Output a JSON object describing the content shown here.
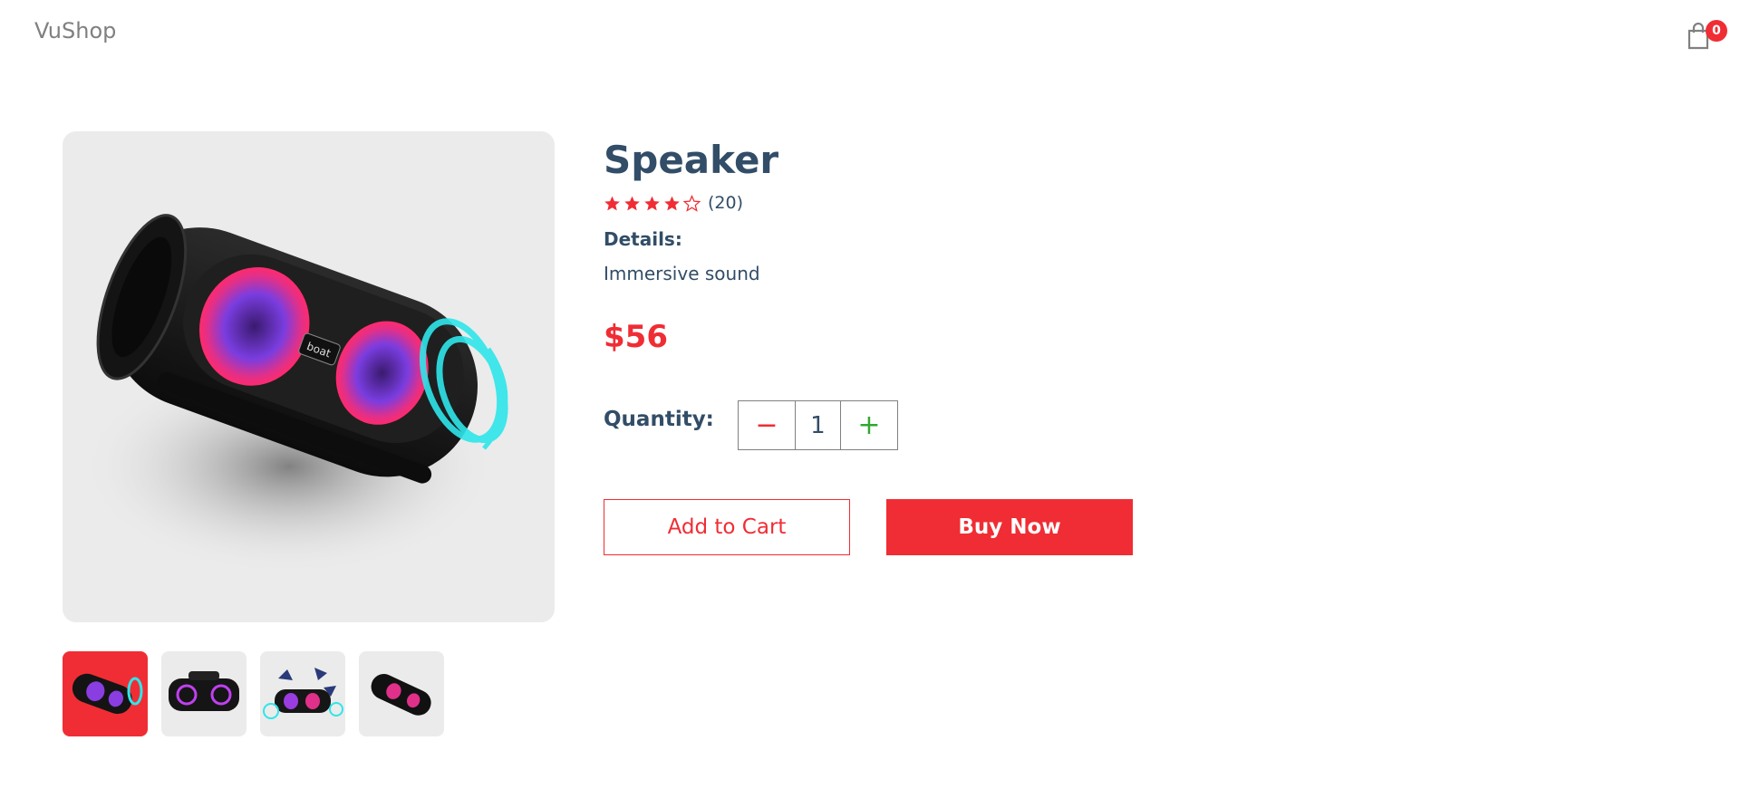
{
  "navbar": {
    "logo": "VuShop",
    "cart_count": "0"
  },
  "product": {
    "title": "Speaker",
    "rating": 4,
    "rating_max": 5,
    "review_count": "(20)",
    "details_label": "Details:",
    "details_text": "Immersive sound",
    "price": "$56"
  },
  "quantity": {
    "label": "Quantity:",
    "minus": "−",
    "value": "1",
    "plus": "+"
  },
  "actions": {
    "add_to_cart": "Add to Cart",
    "buy_now": "Buy Now"
  },
  "colors": {
    "accent": "#f02d34",
    "text": "#324d67",
    "image_bg": "#ebebeb",
    "plus_green": "#31a831"
  },
  "thumbnails": [
    {
      "icon": "speaker-front-glow-thumb",
      "selected": true
    },
    {
      "icon": "boombox-thumb",
      "selected": false
    },
    {
      "icon": "speaker-party-thumb",
      "selected": false
    },
    {
      "icon": "speaker-angled-thumb",
      "selected": false
    }
  ]
}
